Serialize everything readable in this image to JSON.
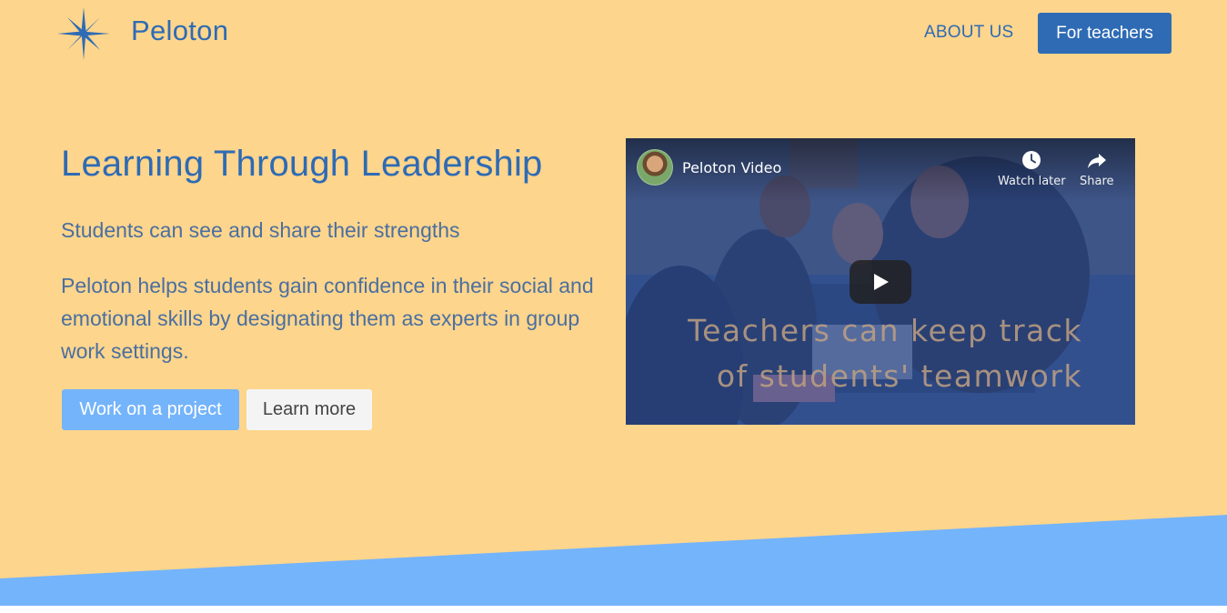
{
  "nav": {
    "brand": "Peloton",
    "logo_icon": "star-burst-icon",
    "about_label": "ABOUT US",
    "teachers_label": "For teachers"
  },
  "hero": {
    "headline": "Learning Through Leadership",
    "subhead": "Students can see and share their strengths",
    "body": "Peloton helps students gain confidence in their social and emotional skills by designating them as experts in group work settings.",
    "primary_button": "Work on a project",
    "secondary_button": "Learn more"
  },
  "video": {
    "title": "Peloton Video",
    "watch_later_label": "Watch later",
    "share_label": "Share",
    "caption_line_1": "Teachers can keep track",
    "caption_line_2": "of students' teamwork",
    "icons": [
      "clock-icon",
      "share-arrow-icon",
      "play-icon"
    ]
  },
  "colors": {
    "background": "#fed58c",
    "brand_blue": "#2e6bb4",
    "light_blue": "#74b4fb",
    "secondary_button": "#f4f4f4"
  }
}
